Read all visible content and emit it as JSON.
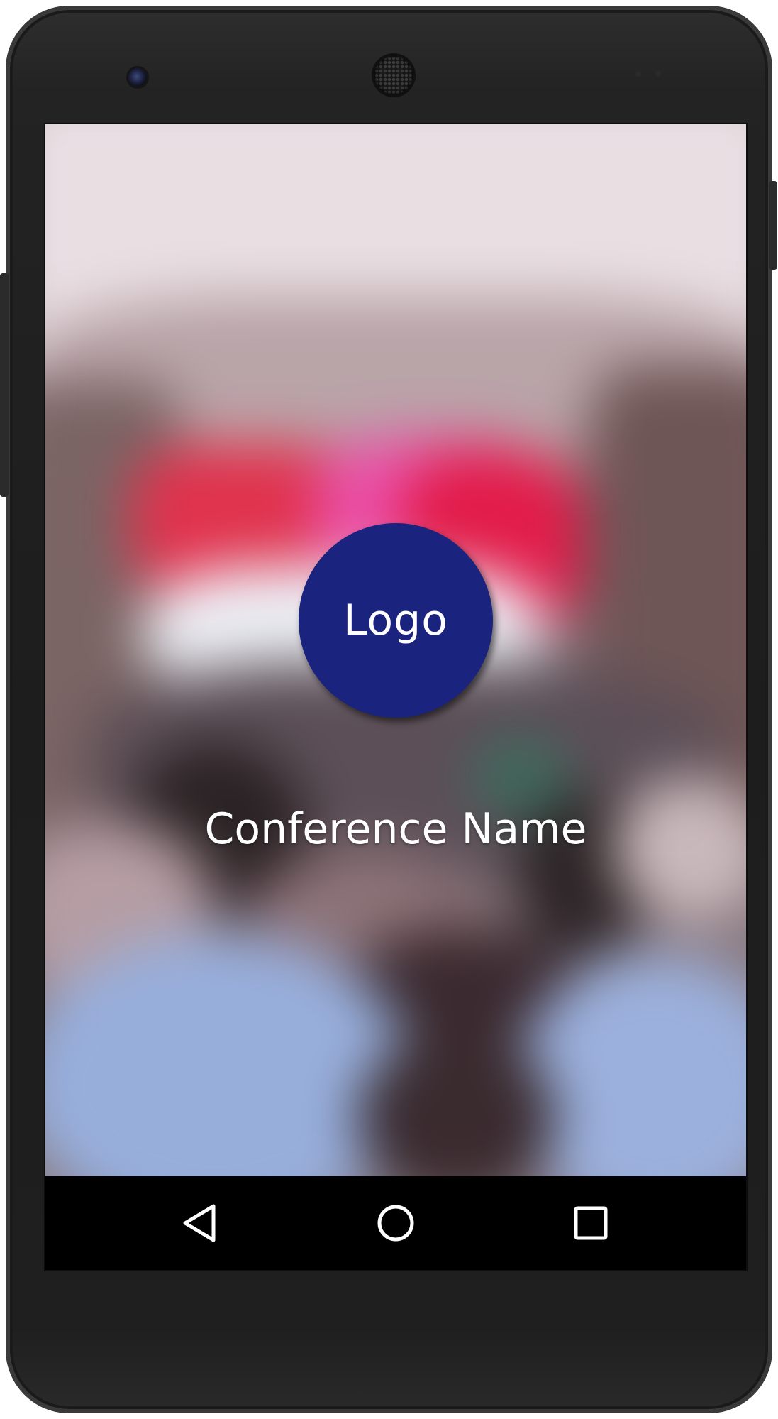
{
  "app": {
    "logo_label": "Logo",
    "conference_name": "Conference Name"
  },
  "colors": {
    "logo_circle": "#1a237e",
    "text": "#ffffff",
    "navbar": "#000000"
  },
  "navbar": {
    "buttons": [
      {
        "icon": "back-triangle-icon"
      },
      {
        "icon": "home-circle-icon"
      },
      {
        "icon": "recents-square-icon"
      }
    ]
  }
}
